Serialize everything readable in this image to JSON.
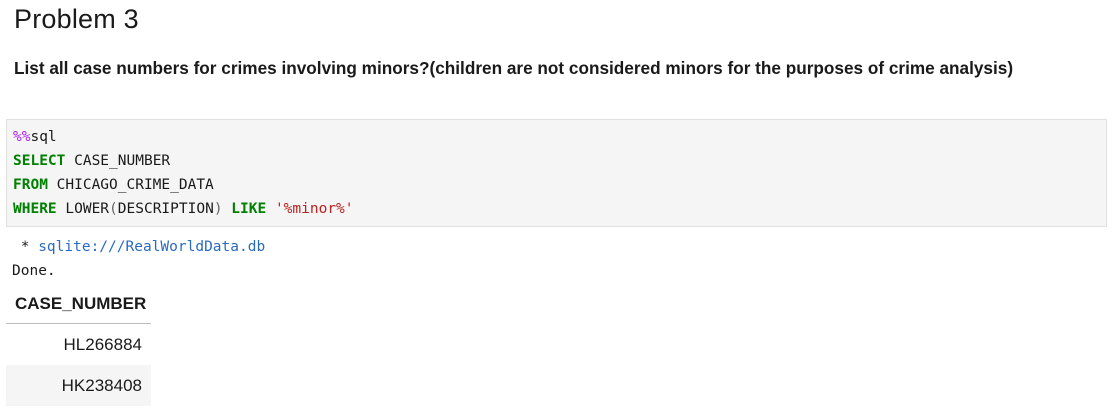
{
  "heading": "Problem 3",
  "question": "List all case numbers for crimes involving minors?(children are not considered minors for the purposes of crime analysis)",
  "code": {
    "magic": "%%",
    "magic_cmd": "sql",
    "line2_kw": "SELECT",
    "line2_rest": " CASE_NUMBER",
    "line3_kw": "FROM",
    "line3_rest": " CHICAGO_CRIME_DATA",
    "line4_kw1": "WHERE",
    "line4_fn": " LOWER",
    "line4_lp": "(",
    "line4_arg": "DESCRIPTION",
    "line4_rp": ")",
    "line4_kw2": "LIKE",
    "line4_str": "'%minor%'"
  },
  "output": {
    "conn_prefix": " * ",
    "conn": "sqlite:///RealWorldData.db",
    "status": "Done."
  },
  "table": {
    "header": "CASE_NUMBER",
    "rows": [
      "HL266884",
      "HK238408"
    ]
  }
}
